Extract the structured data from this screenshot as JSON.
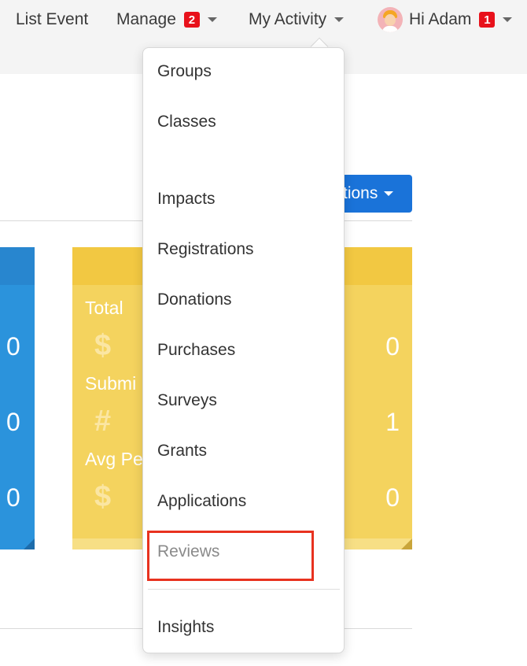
{
  "nav": {
    "list_event": "List Event",
    "manage": {
      "label": "Manage",
      "badge": "2"
    },
    "my_activity": {
      "label": "My Activity"
    },
    "user": {
      "greeting": "Hi Adam",
      "badge": "1"
    }
  },
  "background": {
    "actions_button_partial": "tions",
    "stats": [
      {
        "label": "Total",
        "symbol": "$",
        "left_value": "0",
        "right_value": "0"
      },
      {
        "label": "Submi",
        "symbol": "#",
        "left_value": "0",
        "right_value": "1"
      },
      {
        "label": "Avg Pe",
        "symbol": "$",
        "left_value": "0",
        "right_value": "0"
      }
    ]
  },
  "dropdown": {
    "items": [
      {
        "label": "Groups"
      },
      {
        "label": "Classes"
      },
      {
        "label": "Impacts"
      },
      {
        "label": "Registrations"
      },
      {
        "label": "Donations"
      },
      {
        "label": "Purchases"
      },
      {
        "label": "Surveys"
      },
      {
        "label": "Grants"
      },
      {
        "label": "Applications"
      },
      {
        "label": "Reviews",
        "muted": true,
        "highlighted": true
      },
      {
        "label": "Insights"
      }
    ]
  },
  "colors": {
    "badge": "#e8111b",
    "primary_blue": "#1a73d9",
    "highlight": "#e8321f",
    "card_yellow": "#f4d35e",
    "card_blue": "#2b93dc"
  }
}
